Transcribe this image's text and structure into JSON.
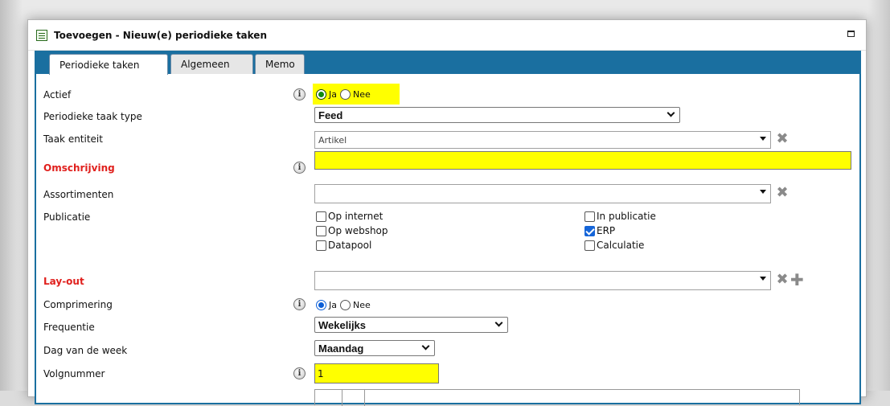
{
  "window": {
    "title": "Toevoegen - Nieuw(e) periodieke taken"
  },
  "tabs": [
    "Periodieke taken",
    "Algemeen",
    "Memo"
  ],
  "fields": {
    "actief": {
      "label": "Actief",
      "options": [
        "Ja",
        "Nee"
      ],
      "selected": "Ja"
    },
    "taak_type": {
      "label": "Periodieke taak type",
      "value": "Feed"
    },
    "taak_entiteit": {
      "label": "Taak entiteit",
      "value": "Artikel"
    },
    "omschrijving": {
      "label": "Omschrijving",
      "value": ""
    },
    "assortimenten": {
      "label": "Assortimenten",
      "value": ""
    },
    "publicatie": {
      "label": "Publicatie",
      "options": [
        {
          "label": "Op internet",
          "checked": false
        },
        {
          "label": "In publicatie",
          "checked": false
        },
        {
          "label": "Op webshop",
          "checked": false
        },
        {
          "label": "ERP",
          "checked": true
        },
        {
          "label": "Datapool",
          "checked": false
        },
        {
          "label": "Calculatie",
          "checked": false
        }
      ]
    },
    "layout": {
      "label": "Lay-out",
      "value": ""
    },
    "comprimering": {
      "label": "Comprimering",
      "options": [
        "Ja",
        "Nee"
      ],
      "selected": "Ja"
    },
    "frequentie": {
      "label": "Frequentie",
      "value": "Wekelijks"
    },
    "dag": {
      "label": "Dag van de week",
      "value": "Maandag"
    },
    "volgnummer": {
      "label": "Volgnummer",
      "value": "1"
    }
  },
  "icons": {
    "info": "info-icon",
    "clear": "clear-x-icon",
    "add": "add-plus-icon"
  },
  "colors": {
    "highlight": "#ffff00",
    "tabbar": "#1a6fa0",
    "required": "#e0201d"
  }
}
